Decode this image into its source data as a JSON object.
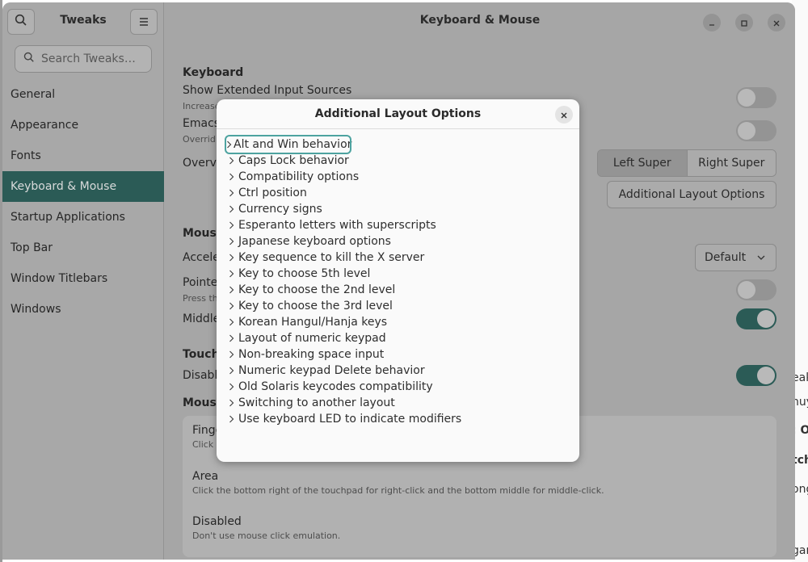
{
  "sidebar": {
    "title": "Tweaks",
    "search_placeholder": "Search Tweaks…",
    "items": [
      {
        "label": "General"
      },
      {
        "label": "Appearance"
      },
      {
        "label": "Fonts"
      },
      {
        "label": "Keyboard & Mouse",
        "active": true
      },
      {
        "label": "Startup Applications"
      },
      {
        "label": "Top Bar"
      },
      {
        "label": "Window Titlebars"
      },
      {
        "label": "Windows"
      }
    ]
  },
  "main": {
    "title": "Keyboard & Mouse",
    "keyboard_section": "Keyboard",
    "show_extended_label": "Show Extended Input Sources",
    "show_extended_sub": "Increase",
    "emacs_label": "Emacs",
    "emacs_sub": "Overrid",
    "overview_label": "Overvi",
    "left_super": "Left Super",
    "right_super": "Right Super",
    "additional_layout_button": "Additional Layout Options",
    "mouse_section": "Mouse",
    "accel_label": "Accele",
    "accel_value": "Default",
    "pointer_label": "Pointe",
    "pointer_sub": "Press th",
    "middle_label": "Middle",
    "touch_section": "Touch",
    "disable_label": "Disabl",
    "mouse_click_section": "Mouse",
    "fingers_title": "Finge",
    "fingers_desc": "Click",
    "area_title": "Area",
    "area_desc": "Click the bottom right of the touchpad for right-click and the bottom middle for middle-click.",
    "disabled_title": "Disabled",
    "disabled_desc": "Don't use mouse click emulation."
  },
  "dialog": {
    "title": "Additional Layout Options",
    "options": [
      "Alt and Win behavior",
      "Caps Lock behavior",
      "Compatibility options",
      "Ctrl position",
      "Currency signs",
      "Esperanto letters with superscripts",
      "Japanese keyboard options",
      "Key sequence to kill the X server",
      "Key to choose 5th level",
      "Key to choose the 2nd level",
      "Key to choose the 3rd level",
      "Korean Hangul/Hanja keys",
      "Layout of numeric keypad",
      "Non-breaking space input",
      "Numeric keypad Delete behavior",
      "Old Solaris keycodes compatibility",
      "Switching to another layout",
      "Use keyboard LED to indicate modifiers"
    ]
  },
  "background_window": {
    "fragments": [
      "eak",
      "huy",
      ": O",
      "tch",
      "ong",
      "gan"
    ]
  },
  "colors": {
    "accent": "#2b5b56",
    "focus_ring": "#4da3a0"
  }
}
